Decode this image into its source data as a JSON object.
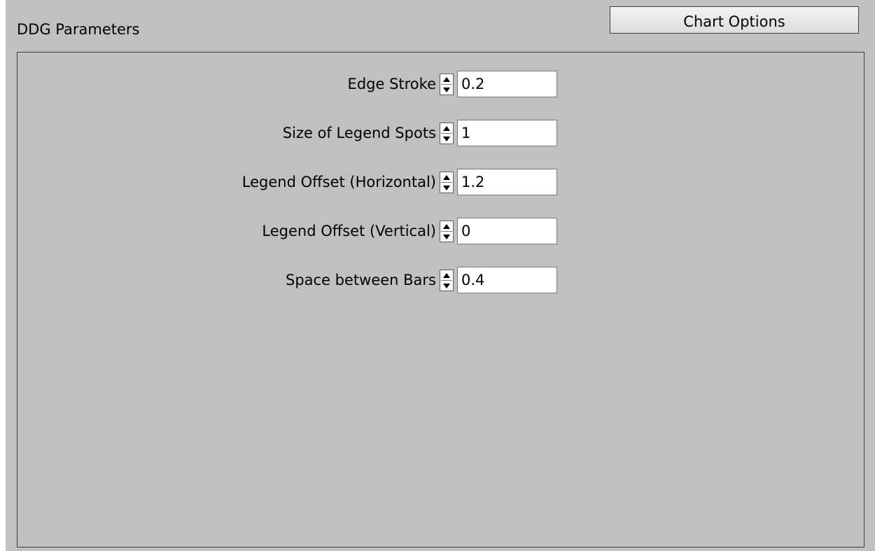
{
  "window": {
    "title": "DDG Parameters",
    "chart_options_label": "Chart Options"
  },
  "params": [
    {
      "label": "Edge Stroke",
      "value": "0.2"
    },
    {
      "label": "Size of Legend Spots",
      "value": "1"
    },
    {
      "label": "Legend Offset (Horizontal)",
      "value": "1.2"
    },
    {
      "label": "Legend Offset (Vertical)",
      "value": "0"
    },
    {
      "label": "Space between Bars",
      "value": "0.4"
    }
  ],
  "icons": {
    "spin_up": "arrow-up-icon",
    "spin_down": "arrow-down-icon"
  },
  "colors": {
    "window_bg": "#c0c0c0",
    "panel_border": "#3c3c3c",
    "field_bg": "#ffffff"
  }
}
